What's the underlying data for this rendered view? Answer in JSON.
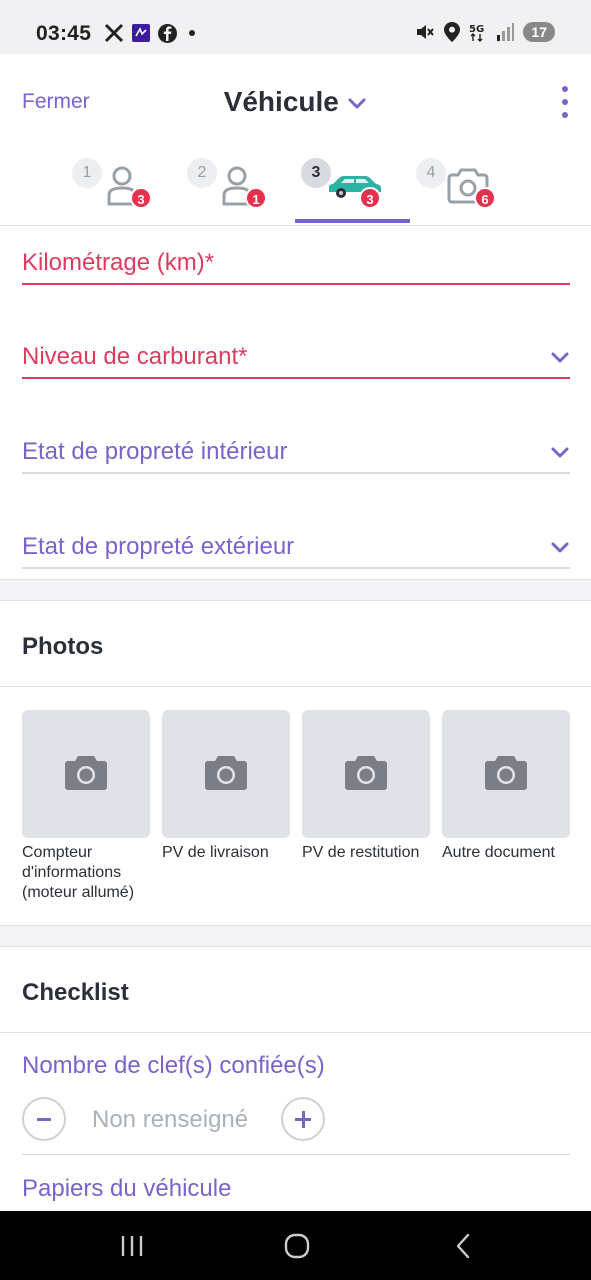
{
  "status_bar": {
    "time": "03:45",
    "battery": "17",
    "icons": [
      "x-logo-icon",
      "app-notification-icon",
      "facebook-icon",
      "dot-icon",
      "mute-icon",
      "location-icon",
      "5g-icon",
      "signal-icon"
    ]
  },
  "header": {
    "close_label": "Fermer",
    "title": "Véhicule",
    "accent_color": "#7b63c9"
  },
  "steps": [
    {
      "number": "1",
      "icon": "person-icon",
      "badge": "3",
      "active": false
    },
    {
      "number": "2",
      "icon": "person-icon",
      "badge": "1",
      "active": false
    },
    {
      "number": "3",
      "icon": "car-icon",
      "badge": "3",
      "active": true
    },
    {
      "number": "4",
      "icon": "camera-icon",
      "badge": "6",
      "active": false
    }
  ],
  "form": {
    "mileage_label": "Kilométrage (km)*",
    "fuel_label": "Niveau de carburant*",
    "interior_label": "Etat de propreté intérieur",
    "exterior_label": "Etat de propreté extérieur",
    "error_color": "#e03a5c"
  },
  "photos": {
    "title": "Photos",
    "items": [
      {
        "label": "Compteur d'informations (moteur allumé)"
      },
      {
        "label": "PV de livraison"
      },
      {
        "label": "PV de restitution"
      },
      {
        "label": "Autre document"
      }
    ]
  },
  "checklist": {
    "title": "Checklist",
    "keys_label": "Nombre de clef(s) confiée(s)",
    "keys_value": "Non renseigné",
    "papers_label": "Papiers du véhicule"
  }
}
